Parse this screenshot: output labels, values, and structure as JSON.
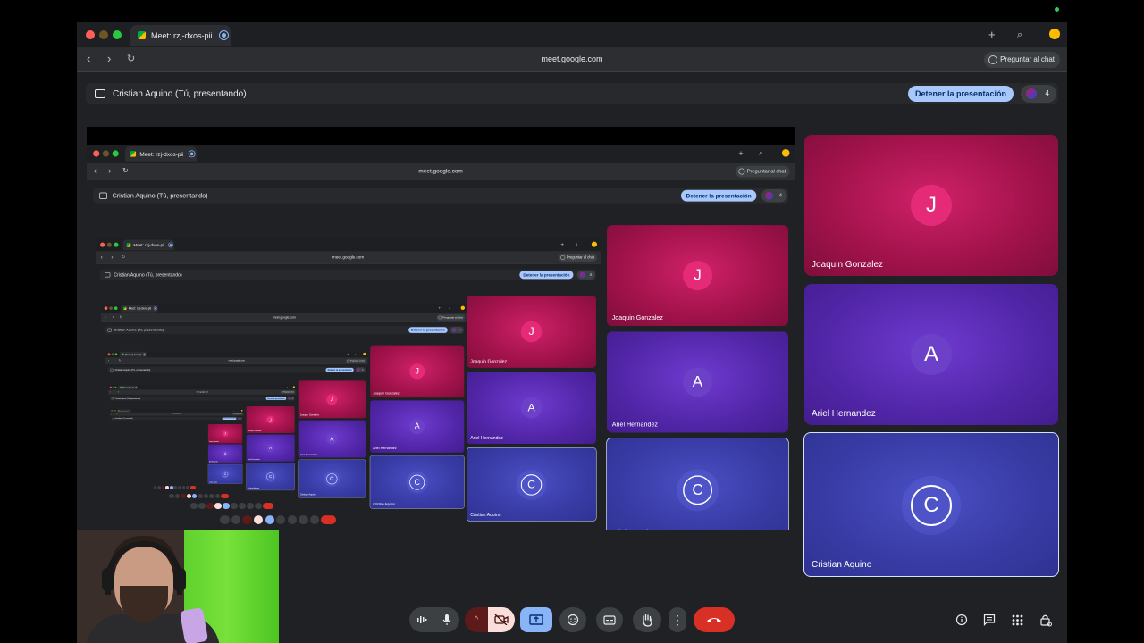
{
  "browser": {
    "tab_title": "Meet: rzj-dxos-pii",
    "url": "meet.google.com",
    "ask_chat_label": "Preguntar al chat"
  },
  "presenting_bar": {
    "text": "Cristian Aquino (Tú, presentando)",
    "stop_label": "Detener la presentación",
    "participant_count": "4"
  },
  "participants": [
    {
      "initial": "J",
      "name": "Joaquin Gonzalez",
      "color": "#a0124a"
    },
    {
      "initial": "A",
      "name": "Ariel Hernandez",
      "color": "#5226a8"
    },
    {
      "initial": "C",
      "name": "Cristian Aquino",
      "color": "#383ba4"
    }
  ],
  "colors": {
    "hangup": "#d93025",
    "present_active": "#8ab4f8",
    "camera_off_bg": "#f9dedc"
  },
  "controls": [
    "captions-icon",
    "mic-icon",
    "chevron-up-icon",
    "camera-off-icon",
    "present-icon",
    "emoji-icon",
    "cc-icon",
    "raise-hand-icon",
    "more-icon",
    "hangup-icon"
  ],
  "right_controls": [
    "info-icon",
    "chat-icon",
    "activities-icon",
    "host-controls-icon"
  ]
}
